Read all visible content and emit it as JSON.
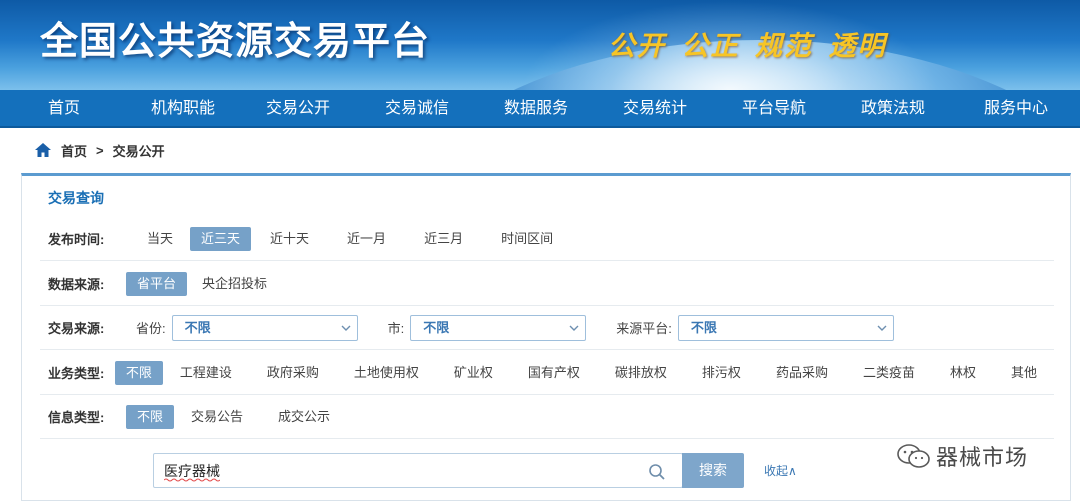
{
  "banner": {
    "title": "全国公共资源交易平台",
    "slogan": "公开 公正 规范 透明"
  },
  "nav": [
    {
      "label": "首页"
    },
    {
      "label": "机构职能"
    },
    {
      "label": "交易公开"
    },
    {
      "label": "交易诚信"
    },
    {
      "label": "数据服务"
    },
    {
      "label": "交易统计"
    },
    {
      "label": "平台导航"
    },
    {
      "label": "政策法规"
    },
    {
      "label": "服务中心"
    }
  ],
  "breadcrumb": {
    "home": "首页",
    "separator": ">",
    "current": "交易公开"
  },
  "panel": {
    "title": "交易查询",
    "publish_time": {
      "label": "发布时间:",
      "options": [
        "当天",
        "近三天",
        "近十天",
        "近一月",
        "近三月",
        "时间区间"
      ],
      "selected": "近三天"
    },
    "data_source": {
      "label": "数据来源:",
      "options": [
        "省平台",
        "央企招投标"
      ],
      "selected": "省平台"
    },
    "trade_source": {
      "label": "交易来源:",
      "province_label": "省份:",
      "province_value": "不限",
      "city_label": "市:",
      "city_value": "不限",
      "platform_label": "来源平台:",
      "platform_value": "不限"
    },
    "business_type": {
      "label": "业务类型:",
      "options": [
        "不限",
        "工程建设",
        "政府采购",
        "土地使用权",
        "矿业权",
        "国有产权",
        "碳排放权",
        "排污权",
        "药品采购",
        "二类疫苗",
        "林权",
        "其他"
      ],
      "selected": "不限"
    },
    "info_type": {
      "label": "信息类型:",
      "options": [
        "不限",
        "交易公告",
        "成交公示"
      ],
      "selected": "不限"
    },
    "search": {
      "value": "医疗器械",
      "button_label": "搜索",
      "collapse_label": "收起∧"
    }
  },
  "watermark": {
    "text": "器械市场"
  },
  "colors": {
    "nav_bg": "#1470bc",
    "active_chip": "#76a1c8",
    "accent_link": "#3a77b3",
    "slogan": "#f7c526"
  }
}
